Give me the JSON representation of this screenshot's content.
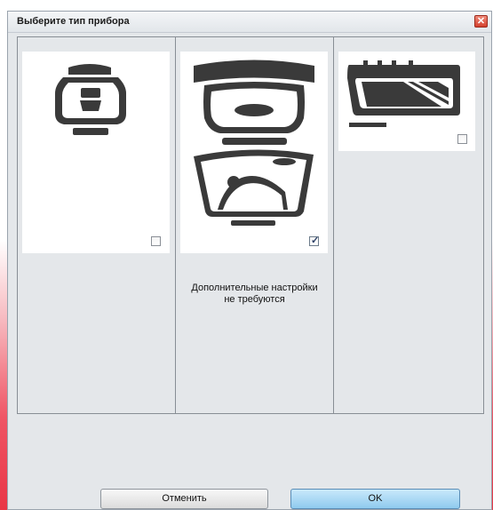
{
  "dialog": {
    "title": "Выберите тип прибора",
    "close_glyph": "✕"
  },
  "devices": [
    {
      "icon": "device-compact-icon",
      "checked": false
    },
    {
      "icon": "device-panoramic-icon",
      "checked": true,
      "note_line1": "Дополнительные настройки",
      "note_line2": "не требуются"
    },
    {
      "icon": "device-wide-icon",
      "checked": false
    }
  ],
  "buttons": {
    "cancel_label": "Отменить",
    "ok_label": "OK"
  },
  "colors": {
    "icon": "#3a3a3a",
    "ok_button": "#9fd3f2",
    "desktop_gradient_bottom": "#e93646"
  }
}
